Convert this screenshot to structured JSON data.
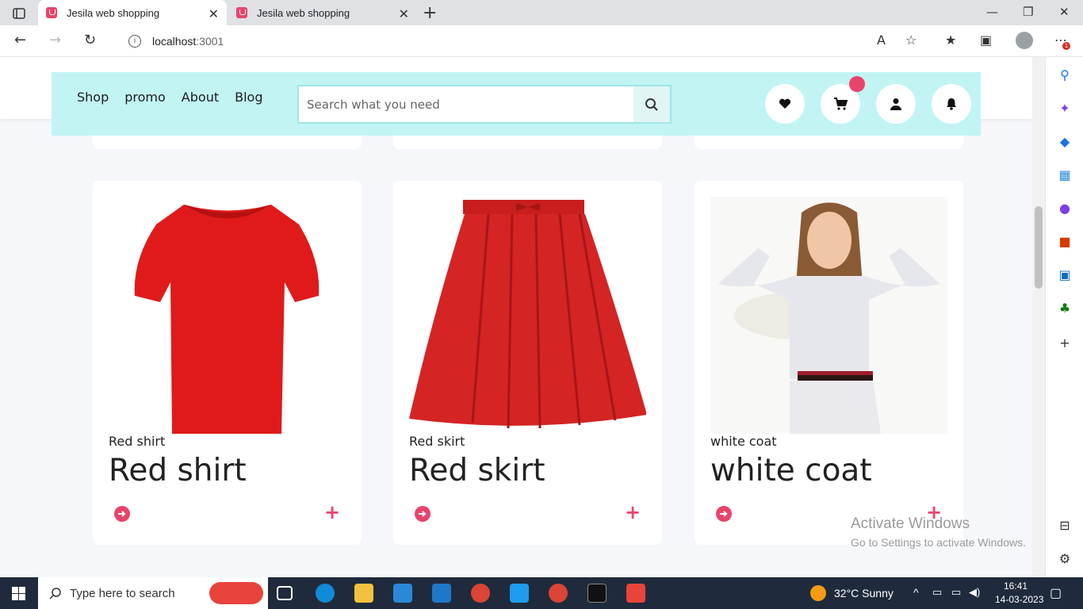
{
  "browser": {
    "tabs": [
      {
        "title": "Jesila web shopping",
        "active": true
      },
      {
        "title": "Jesila web shopping",
        "active": false
      }
    ],
    "address": {
      "host": "localhost",
      "port": ":3001"
    }
  },
  "header": {
    "nav": [
      "Shop",
      "promo",
      "About",
      "Blog"
    ],
    "search_placeholder": "Search what you need"
  },
  "products": [
    {
      "subtitle": "Red shirt",
      "title": "Red shirt"
    },
    {
      "subtitle": "Red skirt",
      "title": "Red skirt"
    },
    {
      "subtitle": "white coat",
      "title": "white coat"
    }
  ],
  "watermark": {
    "line1": "Activate Windows",
    "line2": "Go to Settings to activate Windows."
  },
  "taskbar": {
    "search_placeholder": "Type here to search",
    "weather": "32°C  Sunny",
    "time": "16:41",
    "date": "14-03-2023"
  },
  "colors": {
    "accent": "#e8446b",
    "header_bg": "#c2f4f4"
  }
}
